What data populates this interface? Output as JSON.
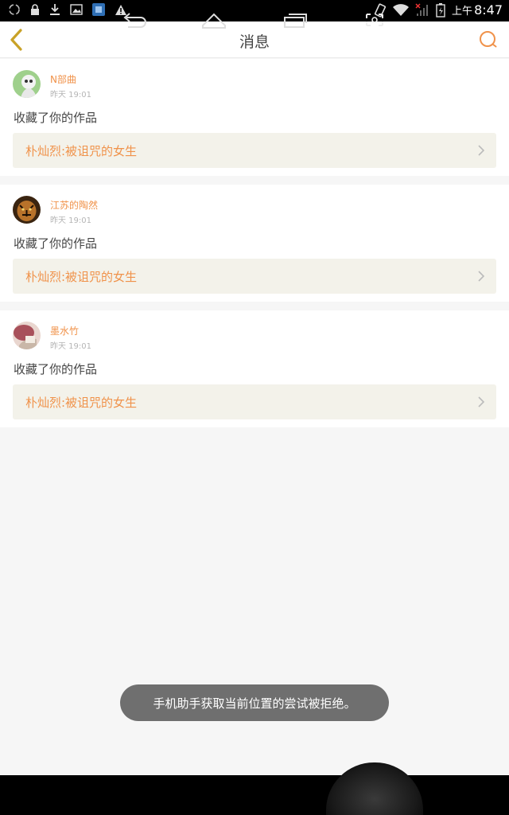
{
  "status_bar": {
    "time_prefix": "上午",
    "time": "8:47"
  },
  "header": {
    "title": "消息"
  },
  "messages": [
    {
      "username": "N部曲",
      "time": "昨天 19:01",
      "action": "收藏了你的作品",
      "work_title": "朴灿烈:被诅咒的女生",
      "avatar_color": "#9fd08c"
    },
    {
      "username": "江苏的陶然",
      "time": "昨天 19:01",
      "action": "收藏了你的作品",
      "work_title": "朴灿烈:被诅咒的女生",
      "avatar_color": "#5a3a1c"
    },
    {
      "username": "墨水竹",
      "time": "昨天 19:01",
      "action": "收藏了你的作品",
      "work_title": "朴灿烈:被诅咒的女生",
      "avatar_color": "#a8505a"
    }
  ],
  "toast": {
    "text": "手机助手获取当前位置的尝试被拒绝。"
  },
  "colors": {
    "accent": "#f0924a",
    "back_icon": "#c9a227",
    "background": "#f6f6f6"
  }
}
